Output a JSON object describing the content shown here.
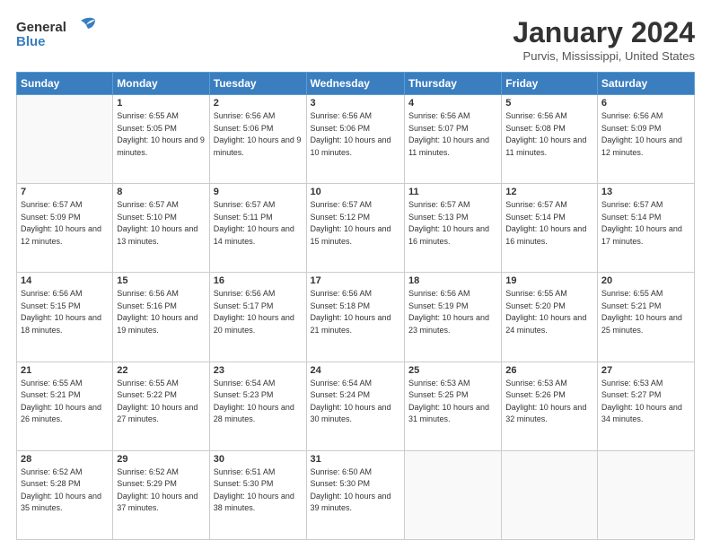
{
  "header": {
    "logo_general": "General",
    "logo_blue": "Blue",
    "month_title": "January 2024",
    "location": "Purvis, Mississippi, United States"
  },
  "weekdays": [
    "Sunday",
    "Monday",
    "Tuesday",
    "Wednesday",
    "Thursday",
    "Friday",
    "Saturday"
  ],
  "weeks": [
    [
      {
        "day": "",
        "sunrise": "",
        "sunset": "",
        "daylight": "",
        "empty": true
      },
      {
        "day": "1",
        "sunrise": "Sunrise: 6:55 AM",
        "sunset": "Sunset: 5:05 PM",
        "daylight": "Daylight: 10 hours and 9 minutes.",
        "empty": false
      },
      {
        "day": "2",
        "sunrise": "Sunrise: 6:56 AM",
        "sunset": "Sunset: 5:06 PM",
        "daylight": "Daylight: 10 hours and 9 minutes.",
        "empty": false
      },
      {
        "day": "3",
        "sunrise": "Sunrise: 6:56 AM",
        "sunset": "Sunset: 5:06 PM",
        "daylight": "Daylight: 10 hours and 10 minutes.",
        "empty": false
      },
      {
        "day": "4",
        "sunrise": "Sunrise: 6:56 AM",
        "sunset": "Sunset: 5:07 PM",
        "daylight": "Daylight: 10 hours and 11 minutes.",
        "empty": false
      },
      {
        "day": "5",
        "sunrise": "Sunrise: 6:56 AM",
        "sunset": "Sunset: 5:08 PM",
        "daylight": "Daylight: 10 hours and 11 minutes.",
        "empty": false
      },
      {
        "day": "6",
        "sunrise": "Sunrise: 6:56 AM",
        "sunset": "Sunset: 5:09 PM",
        "daylight": "Daylight: 10 hours and 12 minutes.",
        "empty": false
      }
    ],
    [
      {
        "day": "7",
        "sunrise": "Sunrise: 6:57 AM",
        "sunset": "Sunset: 5:09 PM",
        "daylight": "Daylight: 10 hours and 12 minutes.",
        "empty": false
      },
      {
        "day": "8",
        "sunrise": "Sunrise: 6:57 AM",
        "sunset": "Sunset: 5:10 PM",
        "daylight": "Daylight: 10 hours and 13 minutes.",
        "empty": false
      },
      {
        "day": "9",
        "sunrise": "Sunrise: 6:57 AM",
        "sunset": "Sunset: 5:11 PM",
        "daylight": "Daylight: 10 hours and 14 minutes.",
        "empty": false
      },
      {
        "day": "10",
        "sunrise": "Sunrise: 6:57 AM",
        "sunset": "Sunset: 5:12 PM",
        "daylight": "Daylight: 10 hours and 15 minutes.",
        "empty": false
      },
      {
        "day": "11",
        "sunrise": "Sunrise: 6:57 AM",
        "sunset": "Sunset: 5:13 PM",
        "daylight": "Daylight: 10 hours and 16 minutes.",
        "empty": false
      },
      {
        "day": "12",
        "sunrise": "Sunrise: 6:57 AM",
        "sunset": "Sunset: 5:14 PM",
        "daylight": "Daylight: 10 hours and 16 minutes.",
        "empty": false
      },
      {
        "day": "13",
        "sunrise": "Sunrise: 6:57 AM",
        "sunset": "Sunset: 5:14 PM",
        "daylight": "Daylight: 10 hours and 17 minutes.",
        "empty": false
      }
    ],
    [
      {
        "day": "14",
        "sunrise": "Sunrise: 6:56 AM",
        "sunset": "Sunset: 5:15 PM",
        "daylight": "Daylight: 10 hours and 18 minutes.",
        "empty": false
      },
      {
        "day": "15",
        "sunrise": "Sunrise: 6:56 AM",
        "sunset": "Sunset: 5:16 PM",
        "daylight": "Daylight: 10 hours and 19 minutes.",
        "empty": false
      },
      {
        "day": "16",
        "sunrise": "Sunrise: 6:56 AM",
        "sunset": "Sunset: 5:17 PM",
        "daylight": "Daylight: 10 hours and 20 minutes.",
        "empty": false
      },
      {
        "day": "17",
        "sunrise": "Sunrise: 6:56 AM",
        "sunset": "Sunset: 5:18 PM",
        "daylight": "Daylight: 10 hours and 21 minutes.",
        "empty": false
      },
      {
        "day": "18",
        "sunrise": "Sunrise: 6:56 AM",
        "sunset": "Sunset: 5:19 PM",
        "daylight": "Daylight: 10 hours and 23 minutes.",
        "empty": false
      },
      {
        "day": "19",
        "sunrise": "Sunrise: 6:55 AM",
        "sunset": "Sunset: 5:20 PM",
        "daylight": "Daylight: 10 hours and 24 minutes.",
        "empty": false
      },
      {
        "day": "20",
        "sunrise": "Sunrise: 6:55 AM",
        "sunset": "Sunset: 5:21 PM",
        "daylight": "Daylight: 10 hours and 25 minutes.",
        "empty": false
      }
    ],
    [
      {
        "day": "21",
        "sunrise": "Sunrise: 6:55 AM",
        "sunset": "Sunset: 5:21 PM",
        "daylight": "Daylight: 10 hours and 26 minutes.",
        "empty": false
      },
      {
        "day": "22",
        "sunrise": "Sunrise: 6:55 AM",
        "sunset": "Sunset: 5:22 PM",
        "daylight": "Daylight: 10 hours and 27 minutes.",
        "empty": false
      },
      {
        "day": "23",
        "sunrise": "Sunrise: 6:54 AM",
        "sunset": "Sunset: 5:23 PM",
        "daylight": "Daylight: 10 hours and 28 minutes.",
        "empty": false
      },
      {
        "day": "24",
        "sunrise": "Sunrise: 6:54 AM",
        "sunset": "Sunset: 5:24 PM",
        "daylight": "Daylight: 10 hours and 30 minutes.",
        "empty": false
      },
      {
        "day": "25",
        "sunrise": "Sunrise: 6:53 AM",
        "sunset": "Sunset: 5:25 PM",
        "daylight": "Daylight: 10 hours and 31 minutes.",
        "empty": false
      },
      {
        "day": "26",
        "sunrise": "Sunrise: 6:53 AM",
        "sunset": "Sunset: 5:26 PM",
        "daylight": "Daylight: 10 hours and 32 minutes.",
        "empty": false
      },
      {
        "day": "27",
        "sunrise": "Sunrise: 6:53 AM",
        "sunset": "Sunset: 5:27 PM",
        "daylight": "Daylight: 10 hours and 34 minutes.",
        "empty": false
      }
    ],
    [
      {
        "day": "28",
        "sunrise": "Sunrise: 6:52 AM",
        "sunset": "Sunset: 5:28 PM",
        "daylight": "Daylight: 10 hours and 35 minutes.",
        "empty": false
      },
      {
        "day": "29",
        "sunrise": "Sunrise: 6:52 AM",
        "sunset": "Sunset: 5:29 PM",
        "daylight": "Daylight: 10 hours and 37 minutes.",
        "empty": false
      },
      {
        "day": "30",
        "sunrise": "Sunrise: 6:51 AM",
        "sunset": "Sunset: 5:30 PM",
        "daylight": "Daylight: 10 hours and 38 minutes.",
        "empty": false
      },
      {
        "day": "31",
        "sunrise": "Sunrise: 6:50 AM",
        "sunset": "Sunset: 5:30 PM",
        "daylight": "Daylight: 10 hours and 39 minutes.",
        "empty": false
      },
      {
        "day": "",
        "sunrise": "",
        "sunset": "",
        "daylight": "",
        "empty": true
      },
      {
        "day": "",
        "sunrise": "",
        "sunset": "",
        "daylight": "",
        "empty": true
      },
      {
        "day": "",
        "sunrise": "",
        "sunset": "",
        "daylight": "",
        "empty": true
      }
    ]
  ]
}
